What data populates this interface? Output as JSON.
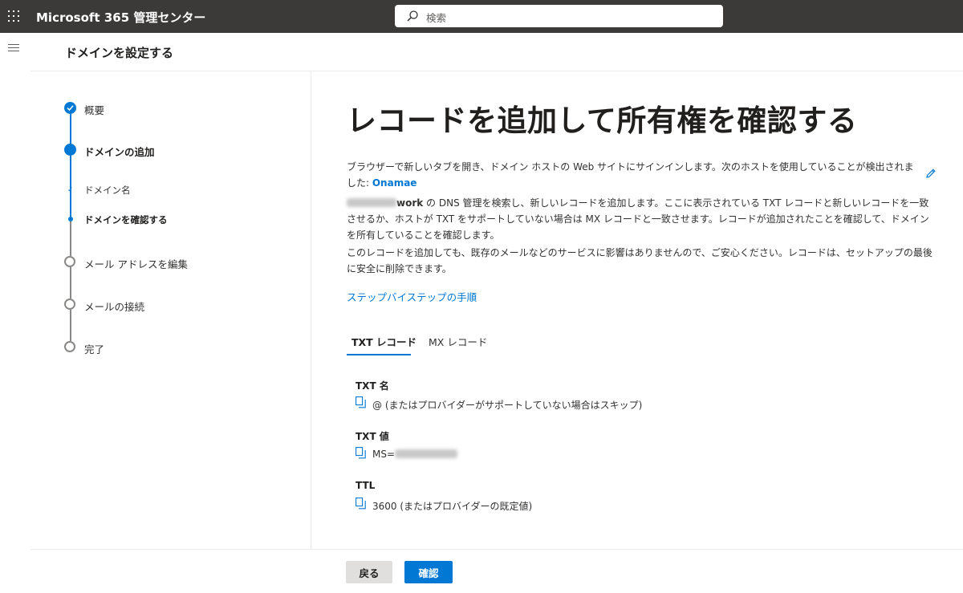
{
  "header": {
    "app_title": "Microsoft 365 管理センター",
    "search_placeholder": "検索"
  },
  "panel": {
    "title": "ドメインを設定する"
  },
  "steps": [
    {
      "label": "概要",
      "state": "completed"
    },
    {
      "label": "ドメインの追加",
      "state": "current"
    },
    {
      "label": "ドメイン名",
      "state": "sub-completed"
    },
    {
      "label": "ドメインを確認する",
      "state": "sub-current"
    },
    {
      "label": "メール アドレスを編集",
      "state": "pending"
    },
    {
      "label": "メールの接続",
      "state": "pending"
    },
    {
      "label": "完了",
      "state": "pending"
    }
  ],
  "main": {
    "title": "レコードを追加して所有権を確認する",
    "p1_text": "ブラウザーで新しいタブを開き、ドメイン ホストの Web サイトにサインインします。次のホストを使用していることが検出されました: ",
    "p1_host": "Onamae",
    "p2_domain_suffix": "work",
    "p2_text": " の DNS 管理を検索し、新しいレコードを追加します。ここに表示されている TXT レコードと新しいレコードを一致させるか、ホストが TXT をサポートしていない場合は MX レコードと一致させます。レコードが追加されたことを確認して、ドメインを所有していることを確認します。",
    "p3_text": "このレコードを追加しても、既存のメールなどのサービスに影響はありませんので、ご安心ください。レコードは、セットアップの最後に安全に削除できます。",
    "step_link": "ステップバイステップの手順"
  },
  "tabs": [
    {
      "label": "TXT レコード",
      "selected": true
    },
    {
      "label": "MX レコード",
      "selected": false
    }
  ],
  "fields": [
    {
      "label": "TXT 名",
      "value": "@ (またはプロバイダーがサポートしていない場合はスキップ)"
    },
    {
      "label": "TXT 値",
      "value": "MS="
    },
    {
      "label": "TTL",
      "value": "3600 (またはプロバイダーの既定値)"
    }
  ],
  "footer": {
    "back_label": "戻る",
    "confirm_label": "確認"
  },
  "colors": {
    "accent": "#0078d4",
    "topbar": "#3b3a39"
  },
  "icons": [
    "waffle-icon",
    "search-icon",
    "hamburger-icon",
    "checkmark-icon",
    "edit-pencil-icon",
    "copy-icon"
  ]
}
